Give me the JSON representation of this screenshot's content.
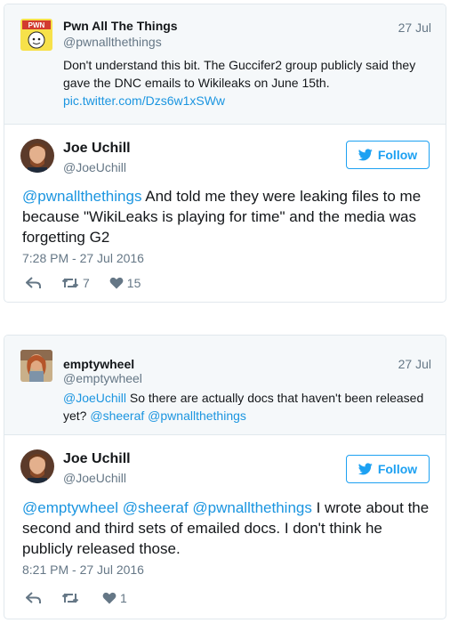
{
  "tweet1": {
    "quoted": {
      "author_name": "Pwn All The Things",
      "author_handle": "@pwnallthethings",
      "date": "27 Jul",
      "text": "Don't understand this bit. The Guccifer2 group publicly said they gave the DNC emails to Wikileaks on June 15th.",
      "link": "pic.twitter.com/Dzs6w1xSWw",
      "avatar_text": "PWN"
    },
    "reply": {
      "author_name": "Joe Uchill",
      "author_handle": "@JoeUchill",
      "follow_label": "Follow",
      "mention": "@pwnallthethings",
      "text": " And told me they were leaking files to me because \"WikiLeaks is playing for time\" and the media was forgetting G2",
      "timestamp": "7:28 PM - 27 Jul 2016",
      "retweets": "7",
      "likes": "15"
    }
  },
  "tweet2": {
    "quoted": {
      "author_name": "emptywheel",
      "author_handle": "@emptywheel",
      "date": "27 Jul",
      "mention": "@JoeUchill",
      "text": " So there are actually docs that haven't been released yet? ",
      "mention2": "@sheeraf",
      "mention3": "@pwnallthethings"
    },
    "reply": {
      "author_name": "Joe Uchill",
      "author_handle": "@JoeUchill",
      "follow_label": "Follow",
      "mention1": "@emptywheel",
      "mention2": "@sheeraf",
      "mention3": "@pwnallthethings",
      "text": " I wrote about the second and third sets of emailed docs. I don't think he publicly released those.",
      "timestamp": "8:21 PM - 27 Jul 2016",
      "retweets": "",
      "likes": "1"
    }
  },
  "colors": {
    "link": "#1b95e0",
    "follow": "#1da1f2",
    "muted": "#657786",
    "quoted_bg": "#f5f8fa"
  }
}
